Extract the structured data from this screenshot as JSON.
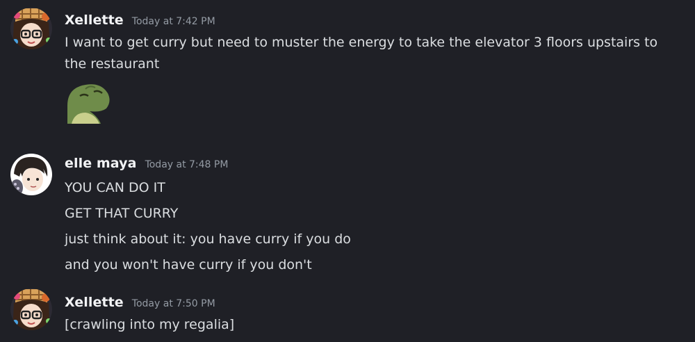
{
  "messages": [
    {
      "username": "Xellette",
      "timestamp": "Today at 7:42 PM",
      "lines": [
        "I want to get curry but need to muster the energy to take the elevator 3 floors upstairs to",
        "the restaurant"
      ],
      "attachment": "frog-emoji"
    },
    {
      "username": "elle maya",
      "timestamp": "Today at 7:48 PM",
      "lines": [
        "YOU CAN DO IT",
        "GET THAT CURRY",
        "just think about it: you have curry if you do",
        "and you won't have curry if you don't"
      ]
    },
    {
      "username": "Xellette",
      "timestamp": "Today at 7:50 PM",
      "lines": [
        "[crawling into my regalia]"
      ]
    }
  ],
  "colors": {
    "background": "#1f2026",
    "username": "#f2f3f5",
    "timestamp": "#949ba4",
    "text": "#dbdee1"
  }
}
